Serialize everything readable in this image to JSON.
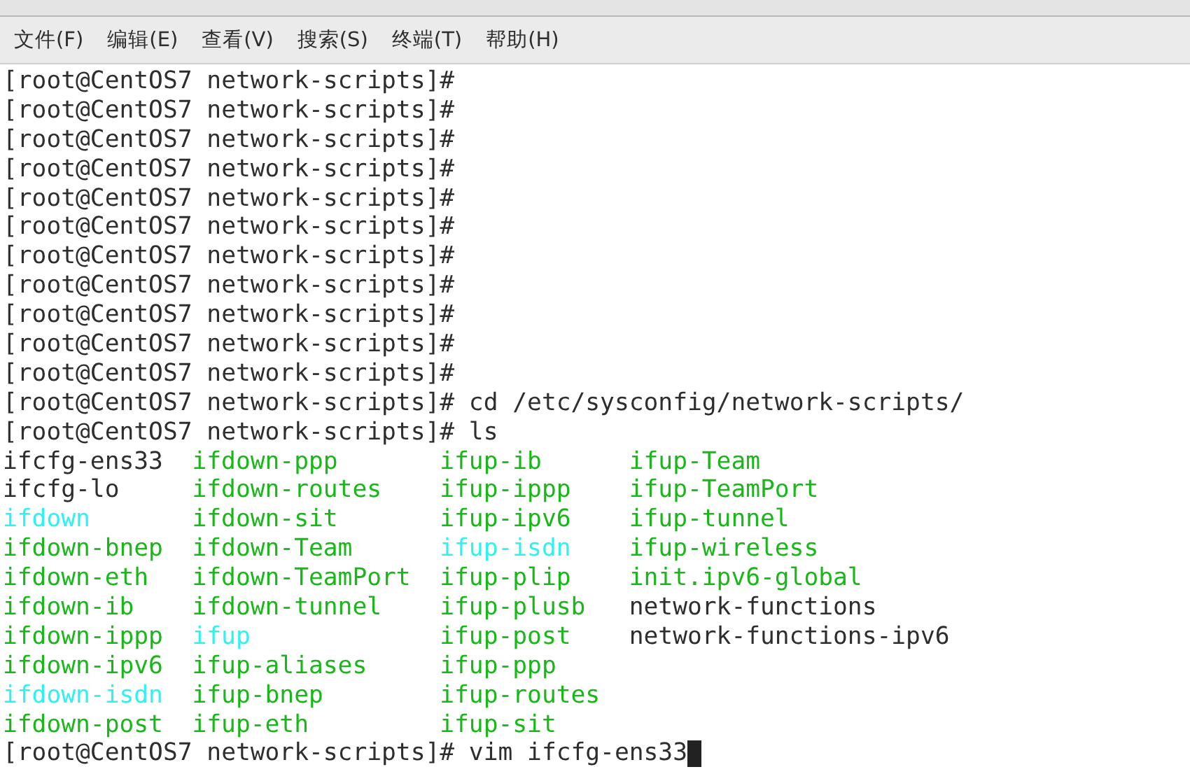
{
  "menu": [
    "文件(F)",
    "编辑(E)",
    "查看(V)",
    "搜索(S)",
    "终端(T)",
    "帮助(H)"
  ],
  "terminal": {
    "lines": [
      {
        "kind": "prompt",
        "prompt": "[root@CentOS7 network-scripts]#"
      },
      {
        "kind": "prompt",
        "prompt": "[root@CentOS7 network-scripts]#"
      },
      {
        "kind": "prompt",
        "prompt": "[root@CentOS7 network-scripts]#"
      },
      {
        "kind": "prompt",
        "prompt": "[root@CentOS7 network-scripts]#"
      },
      {
        "kind": "prompt",
        "prompt": "[root@CentOS7 network-scripts]#"
      },
      {
        "kind": "prompt",
        "prompt": "[root@CentOS7 network-scripts]#"
      },
      {
        "kind": "prompt",
        "prompt": "[root@CentOS7 network-scripts]#"
      },
      {
        "kind": "prompt",
        "prompt": "[root@CentOS7 network-scripts]#"
      },
      {
        "kind": "prompt",
        "prompt": "[root@CentOS7 network-scripts]#"
      },
      {
        "kind": "prompt",
        "prompt": "[root@CentOS7 network-scripts]#"
      },
      {
        "kind": "prompt",
        "prompt": "[root@CentOS7 network-scripts]#"
      },
      {
        "kind": "prompt",
        "prompt": "[root@CentOS7 network-scripts]#",
        "command": "cd /etc/sysconfig/network-scripts/"
      },
      {
        "kind": "prompt",
        "prompt": "[root@CentOS7 network-scripts]#",
        "command": "ls"
      },
      {
        "kind": "listing",
        "entries": [
          {
            "name": "ifcfg-ens33",
            "kind": "file"
          },
          {
            "name": "ifdown-ppp",
            "kind": "executable"
          },
          {
            "name": "ifup-ib",
            "kind": "executable"
          },
          {
            "name": "ifup-Team",
            "kind": "executable"
          }
        ]
      },
      {
        "kind": "listing",
        "entries": [
          {
            "name": "ifcfg-lo",
            "kind": "file"
          },
          {
            "name": "ifdown-routes",
            "kind": "executable"
          },
          {
            "name": "ifup-ippp",
            "kind": "executable"
          },
          {
            "name": "ifup-TeamPort",
            "kind": "executable"
          }
        ]
      },
      {
        "kind": "listing",
        "entries": [
          {
            "name": "ifdown",
            "kind": "link"
          },
          {
            "name": "ifdown-sit",
            "kind": "executable"
          },
          {
            "name": "ifup-ipv6",
            "kind": "executable"
          },
          {
            "name": "ifup-tunnel",
            "kind": "executable"
          }
        ]
      },
      {
        "kind": "listing",
        "entries": [
          {
            "name": "ifdown-bnep",
            "kind": "executable"
          },
          {
            "name": "ifdown-Team",
            "kind": "executable"
          },
          {
            "name": "ifup-isdn",
            "kind": "link"
          },
          {
            "name": "ifup-wireless",
            "kind": "executable"
          }
        ]
      },
      {
        "kind": "listing",
        "entries": [
          {
            "name": "ifdown-eth",
            "kind": "executable"
          },
          {
            "name": "ifdown-TeamPort",
            "kind": "executable"
          },
          {
            "name": "ifup-plip",
            "kind": "executable"
          },
          {
            "name": "init.ipv6-global",
            "kind": "executable"
          }
        ]
      },
      {
        "kind": "listing",
        "entries": [
          {
            "name": "ifdown-ib",
            "kind": "executable"
          },
          {
            "name": "ifdown-tunnel",
            "kind": "executable"
          },
          {
            "name": "ifup-plusb",
            "kind": "executable"
          },
          {
            "name": "network-functions",
            "kind": "file"
          }
        ]
      },
      {
        "kind": "listing",
        "entries": [
          {
            "name": "ifdown-ippp",
            "kind": "executable"
          },
          {
            "name": "ifup",
            "kind": "link"
          },
          {
            "name": "ifup-post",
            "kind": "executable"
          },
          {
            "name": "network-functions-ipv6",
            "kind": "file"
          }
        ]
      },
      {
        "kind": "listing",
        "entries": [
          {
            "name": "ifdown-ipv6",
            "kind": "executable"
          },
          {
            "name": "ifup-aliases",
            "kind": "executable"
          },
          {
            "name": "ifup-ppp",
            "kind": "executable"
          }
        ]
      },
      {
        "kind": "listing",
        "entries": [
          {
            "name": "ifdown-isdn",
            "kind": "link"
          },
          {
            "name": "ifup-bnep",
            "kind": "executable"
          },
          {
            "name": "ifup-routes",
            "kind": "executable"
          }
        ]
      },
      {
        "kind": "listing",
        "entries": [
          {
            "name": "ifdown-post",
            "kind": "executable"
          },
          {
            "name": "ifup-eth",
            "kind": "executable"
          },
          {
            "name": "ifup-sit",
            "kind": "executable"
          }
        ]
      },
      {
        "kind": "prompt",
        "prompt": "[root@CentOS7 network-scripts]#",
        "command": "vim ifcfg-ens33",
        "cursor": true
      }
    ]
  }
}
